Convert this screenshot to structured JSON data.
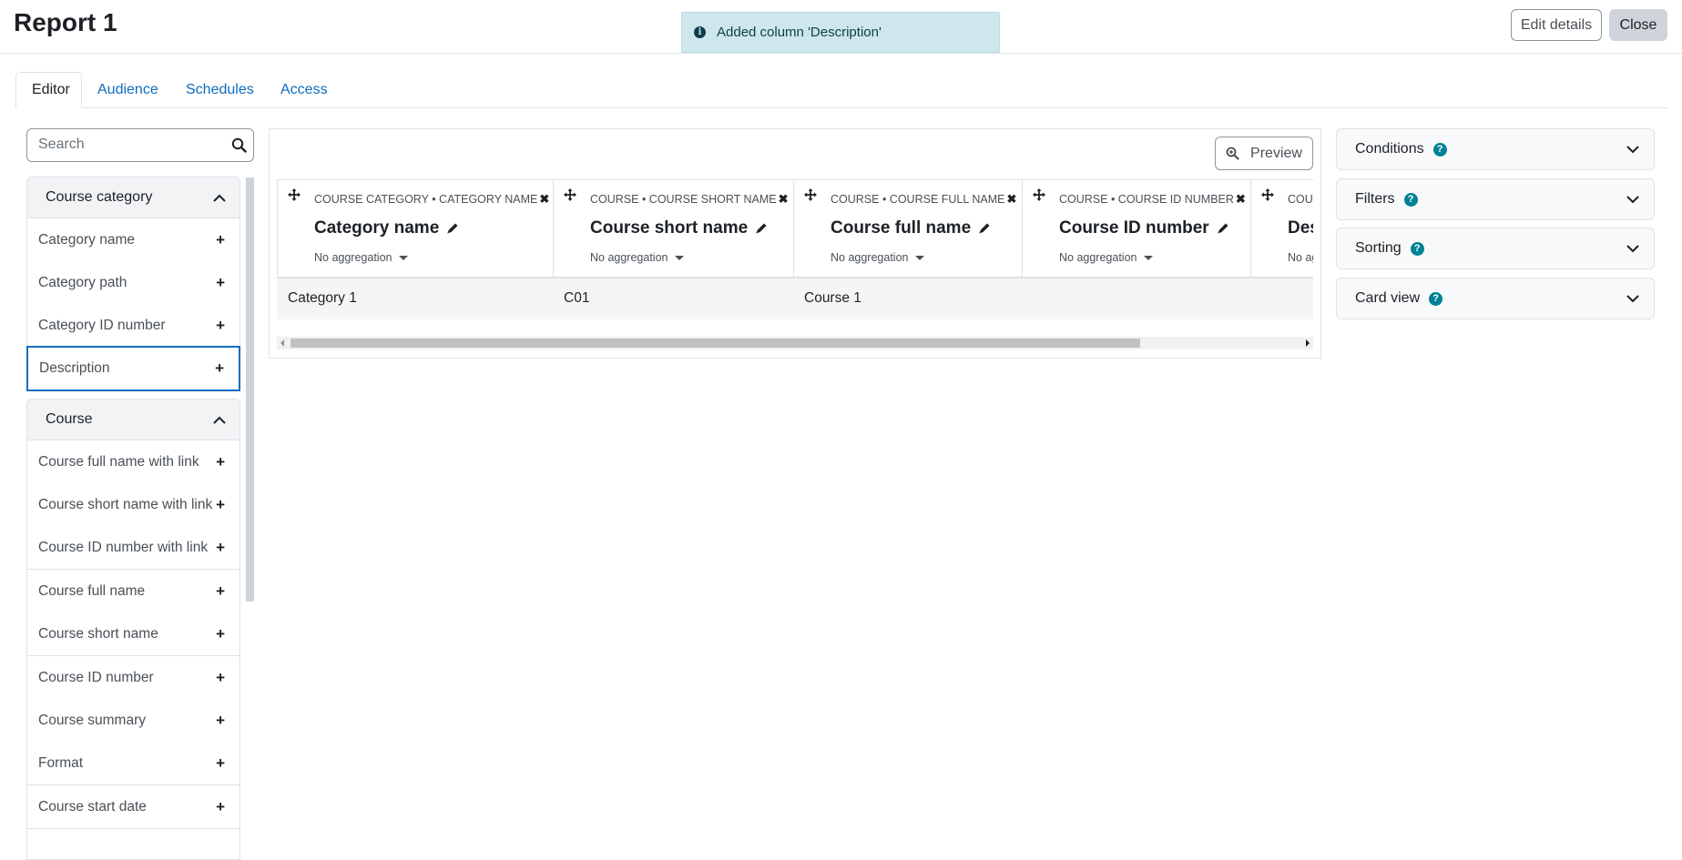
{
  "header": {
    "title": "Report 1",
    "edit_details_label": "Edit details",
    "close_label": "Close"
  },
  "toast": {
    "message": "Added column 'Description'",
    "icon": "info-icon"
  },
  "tabs": [
    {
      "label": "Editor",
      "active": true
    },
    {
      "label": "Audience",
      "active": false
    },
    {
      "label": "Schedules",
      "active": false
    },
    {
      "label": "Access",
      "active": false
    }
  ],
  "search": {
    "placeholder": "Search",
    "value": ""
  },
  "sidebar": {
    "categories": [
      {
        "name": "Course category",
        "expanded": true,
        "items": [
          "Category name",
          "Category path",
          "Category ID number",
          "Description"
        ]
      },
      {
        "name": "Course",
        "expanded": true,
        "items": [
          "Course full name with link",
          "Course short name with link",
          "Course ID number with link",
          "Course full name",
          "Course short name",
          "Course ID number",
          "Course summary",
          "Format",
          "Course start date"
        ]
      }
    ]
  },
  "report": {
    "preview_label": "Preview",
    "columns": [
      {
        "source": "COURSE CATEGORY • CATEGORY NAME",
        "title": "Category name",
        "aggregation": "No aggregation"
      },
      {
        "source": "COURSE • COURSE SHORT NAME",
        "title": "Course short name",
        "aggregation": "No aggregation"
      },
      {
        "source": "COURSE • COURSE FULL NAME",
        "title": "Course full name",
        "aggregation": "No aggregation"
      },
      {
        "source": "COURSE • COURSE ID NUMBER",
        "title": "Course ID number",
        "aggregation": "No aggregation"
      },
      {
        "source": "COURSE CATEGORY • DESCRIPTION",
        "title": "Description",
        "aggregation": "No aggregation"
      }
    ],
    "rows": [
      [
        "Category 1",
        "C01",
        "Course 1",
        "",
        ""
      ]
    ]
  },
  "panels": [
    {
      "label": "Conditions"
    },
    {
      "label": "Filters"
    },
    {
      "label": "Sorting"
    },
    {
      "label": "Card view"
    }
  ],
  "colors": {
    "link": "#0f6cbf",
    "toast_bg": "#cee7ec",
    "help_icon": "#008196",
    "focus_border": "#0f6cbf"
  }
}
